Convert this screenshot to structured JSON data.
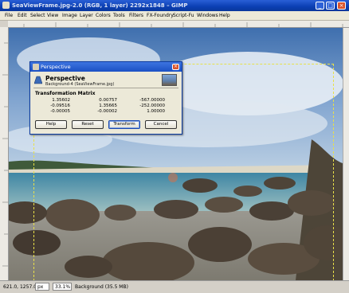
{
  "window": {
    "title": "SeaViewFrame.jpg-2.0 (RGB, 1 layer) 2292x1848 – GIMP"
  },
  "menu": [
    "File",
    "Edit",
    "Select",
    "View",
    "Image",
    "Layer",
    "Colors",
    "Tools",
    "Filters",
    "FX-Foundry",
    "Script-Fu",
    "Windows",
    "Help"
  ],
  "dialog": {
    "title": "Perspective",
    "heading": "Perspective",
    "subheading": "Background-4 (SeaViewFrame.jpg)",
    "matrix_title": "Transformation Matrix",
    "matrix": [
      [
        "1.35602",
        "0.00757",
        "-567.00000"
      ],
      [
        "-0.09516",
        "1.35665",
        "-252.00000"
      ],
      [
        "-0.00005",
        "-0.00002",
        "1.00000"
      ]
    ],
    "buttons": {
      "help": "Help",
      "reset": "Reset",
      "transform": "Transform",
      "cancel": "Cancel"
    }
  },
  "status": {
    "coords": "621.0, 1257.0",
    "unit": "px",
    "zoom": "33.1%",
    "layer_info": "Background (35.5 MB)"
  },
  "colors": {
    "title_bar": "#0b3fb3",
    "selection_dash": "#e8e04a"
  }
}
